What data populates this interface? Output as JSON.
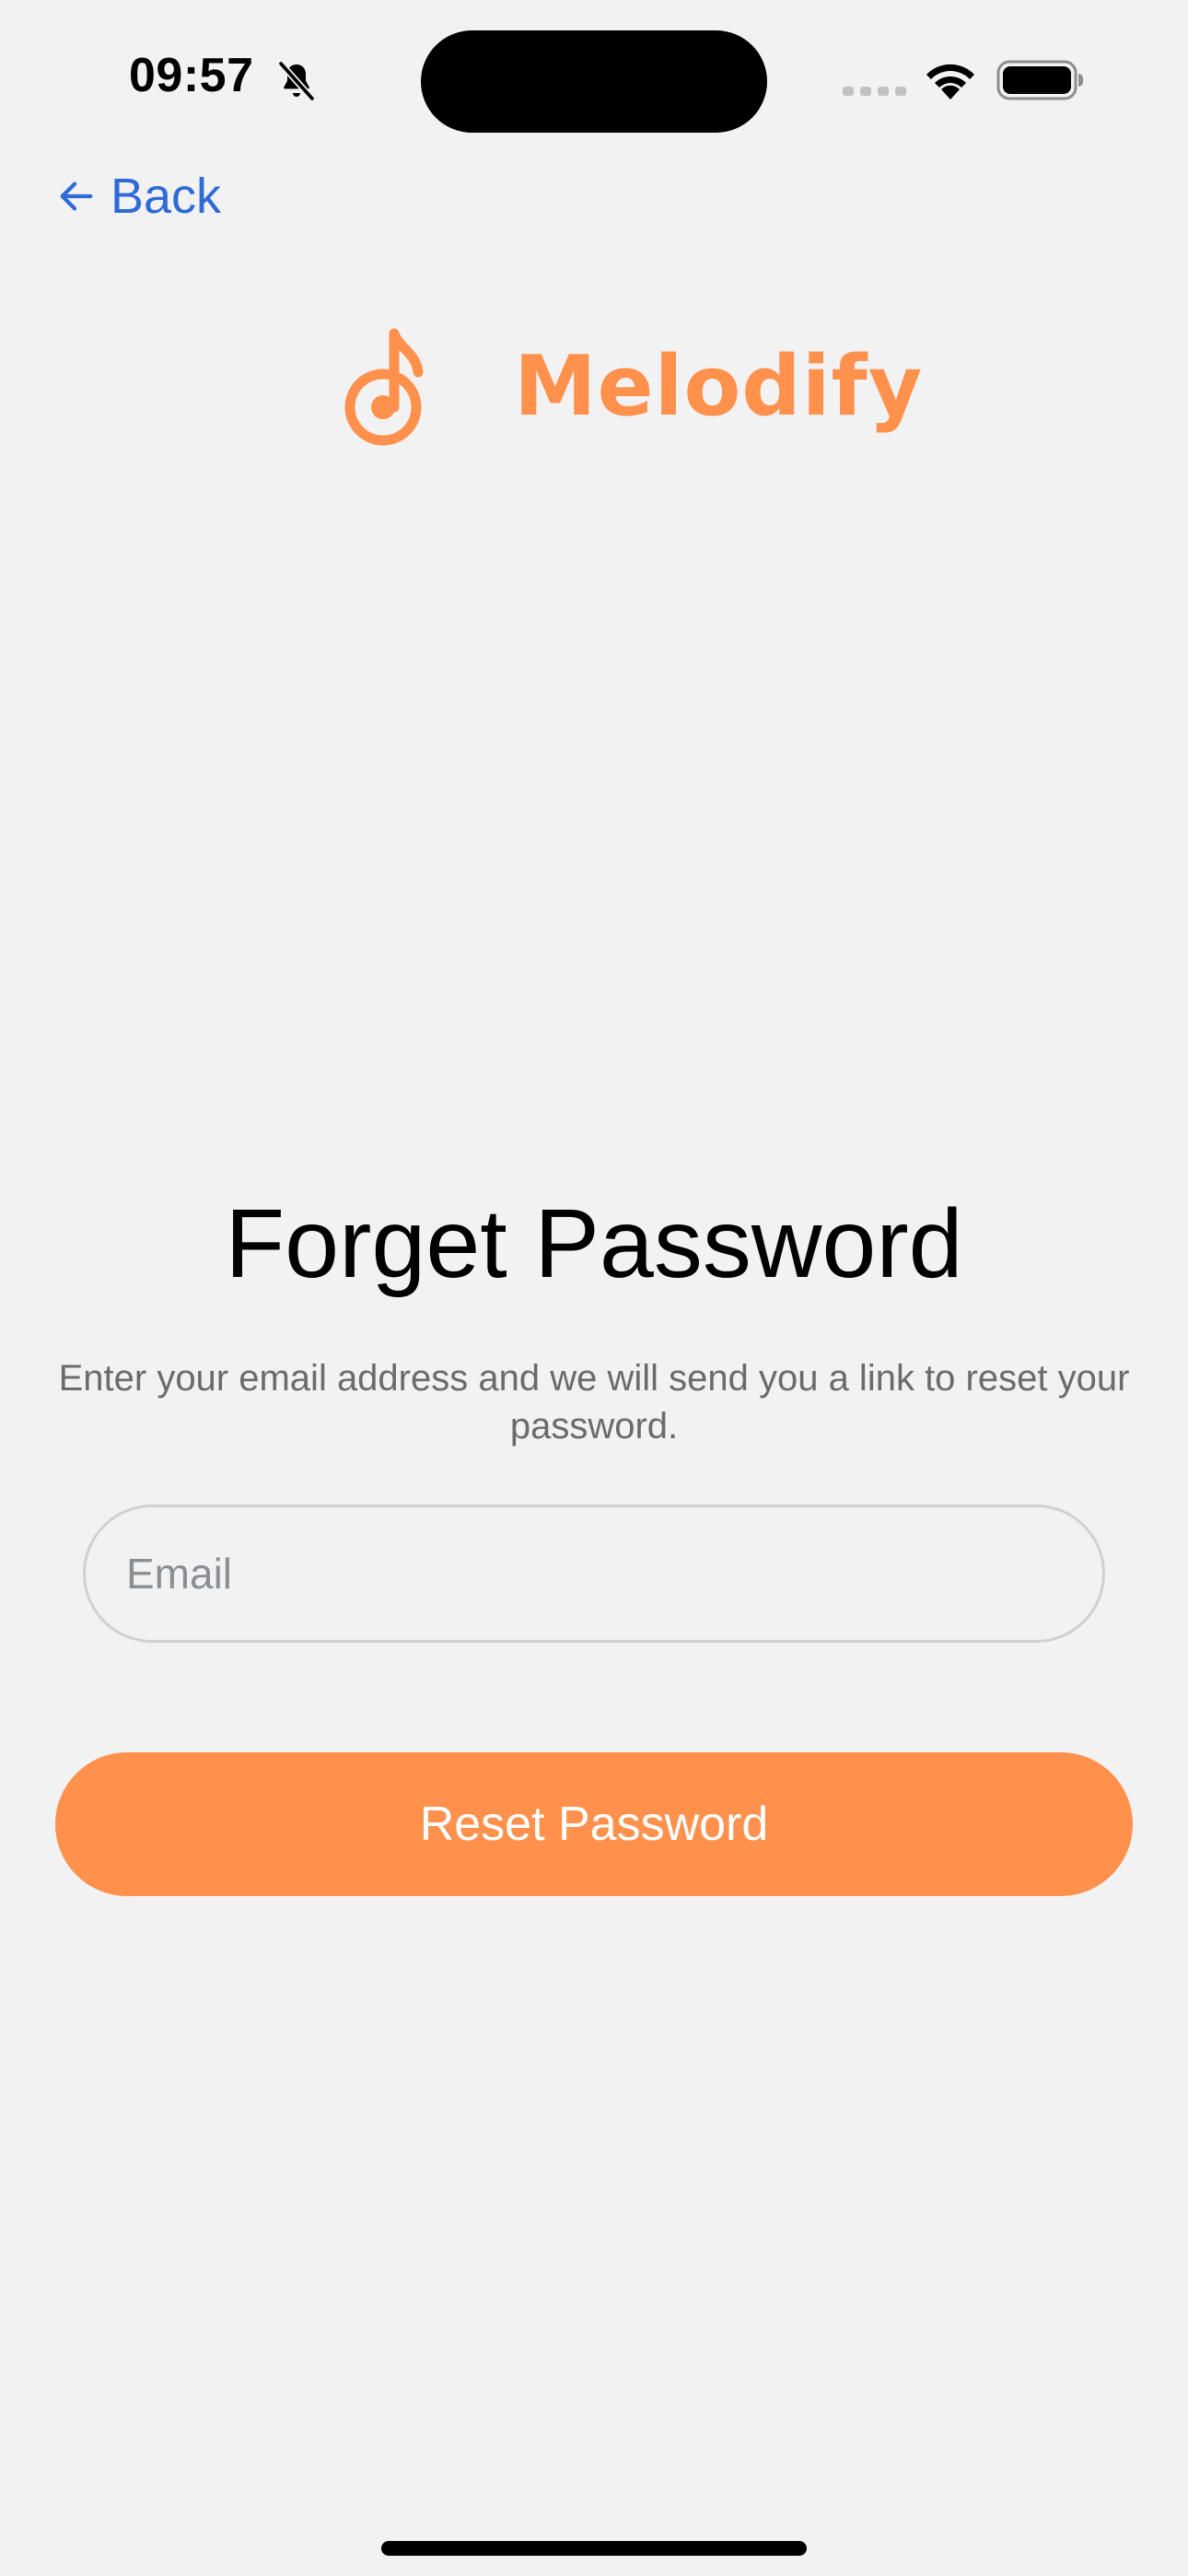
{
  "status_bar": {
    "time": "09:57",
    "icons": [
      "bell-muted-icon",
      "signal-icon",
      "wifi-icon",
      "battery-icon"
    ]
  },
  "nav": {
    "back_label": "Back",
    "back_icon": "arrow-left-icon"
  },
  "brand": {
    "name": "Melodify",
    "logo_icon": "music-note-icon",
    "color": "#ff914d"
  },
  "form": {
    "title": "Forget Password",
    "description": "Enter your email address and we will send you a link to reset your password.",
    "email_placeholder": "Email",
    "email_value": "",
    "submit_label": "Reset Password"
  },
  "colors": {
    "accent": "#ff914d",
    "link": "#2f6bd8",
    "background": "#f2f2f2"
  }
}
